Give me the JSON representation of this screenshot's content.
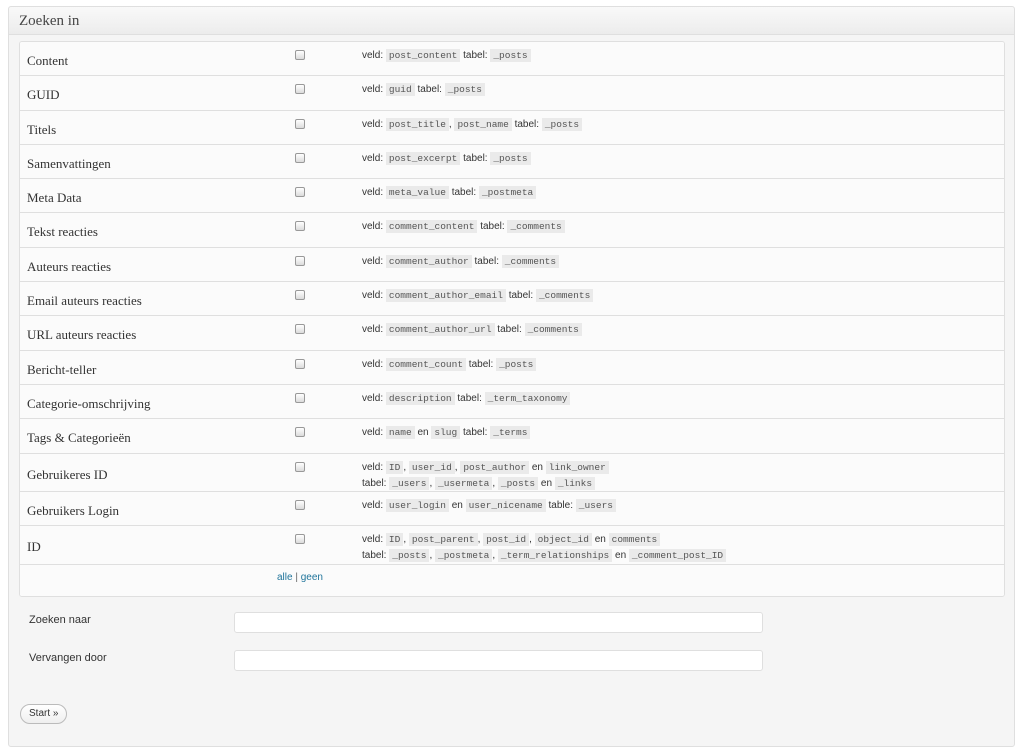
{
  "panel": {
    "title": "Zoeken in"
  },
  "rows": [
    {
      "label": "Content",
      "lines": [
        [
          [
            "t",
            "veld: "
          ],
          [
            "c",
            "post_content"
          ],
          [
            "t",
            " tabel: "
          ],
          [
            "c",
            "_posts"
          ]
        ]
      ]
    },
    {
      "label": "GUID",
      "lines": [
        [
          [
            "t",
            "veld: "
          ],
          [
            "c",
            "guid"
          ],
          [
            "t",
            " tabel: "
          ],
          [
            "c",
            "_posts"
          ]
        ]
      ]
    },
    {
      "label": "Titels",
      "lines": [
        [
          [
            "t",
            "veld: "
          ],
          [
            "c",
            "post_title"
          ],
          [
            "t",
            ", "
          ],
          [
            "c",
            "post_name"
          ],
          [
            "t",
            " tabel: "
          ],
          [
            "c",
            "_posts"
          ]
        ]
      ]
    },
    {
      "label": "Samenvattingen",
      "lines": [
        [
          [
            "t",
            "veld: "
          ],
          [
            "c",
            "post_excerpt"
          ],
          [
            "t",
            " tabel: "
          ],
          [
            "c",
            "_posts"
          ]
        ]
      ]
    },
    {
      "label": "Meta Data",
      "lines": [
        [
          [
            "t",
            "veld: "
          ],
          [
            "c",
            "meta_value"
          ],
          [
            "t",
            " tabel: "
          ],
          [
            "c",
            "_postmeta"
          ]
        ]
      ]
    },
    {
      "label": "Tekst reacties",
      "lines": [
        [
          [
            "t",
            "veld: "
          ],
          [
            "c",
            "comment_content"
          ],
          [
            "t",
            " tabel: "
          ],
          [
            "c",
            "_comments"
          ]
        ]
      ]
    },
    {
      "label": "Auteurs reacties",
      "lines": [
        [
          [
            "t",
            "veld: "
          ],
          [
            "c",
            "comment_author"
          ],
          [
            "t",
            " tabel: "
          ],
          [
            "c",
            "_comments"
          ]
        ]
      ]
    },
    {
      "label": "Email auteurs reacties",
      "lines": [
        [
          [
            "t",
            "veld: "
          ],
          [
            "c",
            "comment_author_email"
          ],
          [
            "t",
            " tabel: "
          ],
          [
            "c",
            "_comments"
          ]
        ]
      ]
    },
    {
      "label": "URL auteurs reacties",
      "lines": [
        [
          [
            "t",
            "veld: "
          ],
          [
            "c",
            "comment_author_url"
          ],
          [
            "t",
            " tabel: "
          ],
          [
            "c",
            "_comments"
          ]
        ]
      ]
    },
    {
      "label": "Bericht-teller",
      "lines": [
        [
          [
            "t",
            "veld: "
          ],
          [
            "c",
            "comment_count"
          ],
          [
            "t",
            " tabel: "
          ],
          [
            "c",
            "_posts"
          ]
        ]
      ]
    },
    {
      "label": "Categorie-omschrijving",
      "lines": [
        [
          [
            "t",
            "veld: "
          ],
          [
            "c",
            "description"
          ],
          [
            "t",
            " tabel: "
          ],
          [
            "c",
            "_term_taxonomy"
          ]
        ]
      ]
    },
    {
      "label": "Tags & Categorieën",
      "lines": [
        [
          [
            "t",
            "veld: "
          ],
          [
            "c",
            "name"
          ],
          [
            "t",
            " en "
          ],
          [
            "c",
            "slug"
          ],
          [
            "t",
            " tabel: "
          ],
          [
            "c",
            "_terms"
          ]
        ]
      ]
    },
    {
      "label": "Gebruikeres ID",
      "lines": [
        [
          [
            "t",
            "veld: "
          ],
          [
            "c",
            "ID"
          ],
          [
            "t",
            ", "
          ],
          [
            "c",
            "user_id"
          ],
          [
            "t",
            ", "
          ],
          [
            "c",
            "post_author"
          ],
          [
            "t",
            " en "
          ],
          [
            "c",
            "link_owner"
          ]
        ],
        [
          [
            "t",
            "tabel: "
          ],
          [
            "c",
            "_users"
          ],
          [
            "t",
            ", "
          ],
          [
            "c",
            "_usermeta"
          ],
          [
            "t",
            ", "
          ],
          [
            "c",
            "_posts"
          ],
          [
            "t",
            " en "
          ],
          [
            "c",
            "_links"
          ]
        ]
      ]
    },
    {
      "label": "Gebruikers Login",
      "lines": [
        [
          [
            "t",
            "veld: "
          ],
          [
            "c",
            "user_login"
          ],
          [
            "t",
            " en "
          ],
          [
            "c",
            "user_nicename"
          ],
          [
            "t",
            " table: "
          ],
          [
            "c",
            "_users"
          ]
        ]
      ]
    },
    {
      "label": "ID",
      "lines": [
        [
          [
            "t",
            "veld: "
          ],
          [
            "c",
            "ID"
          ],
          [
            "t",
            ", "
          ],
          [
            "c",
            "post_parent"
          ],
          [
            "t",
            ", "
          ],
          [
            "c",
            "post_id"
          ],
          [
            "t",
            ", "
          ],
          [
            "c",
            "object_id"
          ],
          [
            "t",
            " en "
          ],
          [
            "c",
            "comments"
          ]
        ],
        [
          [
            "t",
            "tabel: "
          ],
          [
            "c",
            "_posts"
          ],
          [
            "t",
            ", "
          ],
          [
            "c",
            "_postmeta"
          ],
          [
            "t",
            ", "
          ],
          [
            "c",
            "_term_relationships"
          ],
          [
            "t",
            " en "
          ],
          [
            "c",
            "_comment_post_ID"
          ]
        ]
      ]
    }
  ],
  "toggle": {
    "all": "alle",
    "separator": " | ",
    "none": "geen"
  },
  "search": {
    "label": "Zoeken naar",
    "value": ""
  },
  "replace": {
    "label": "Vervangen door",
    "value": ""
  },
  "start_button": "Start »"
}
